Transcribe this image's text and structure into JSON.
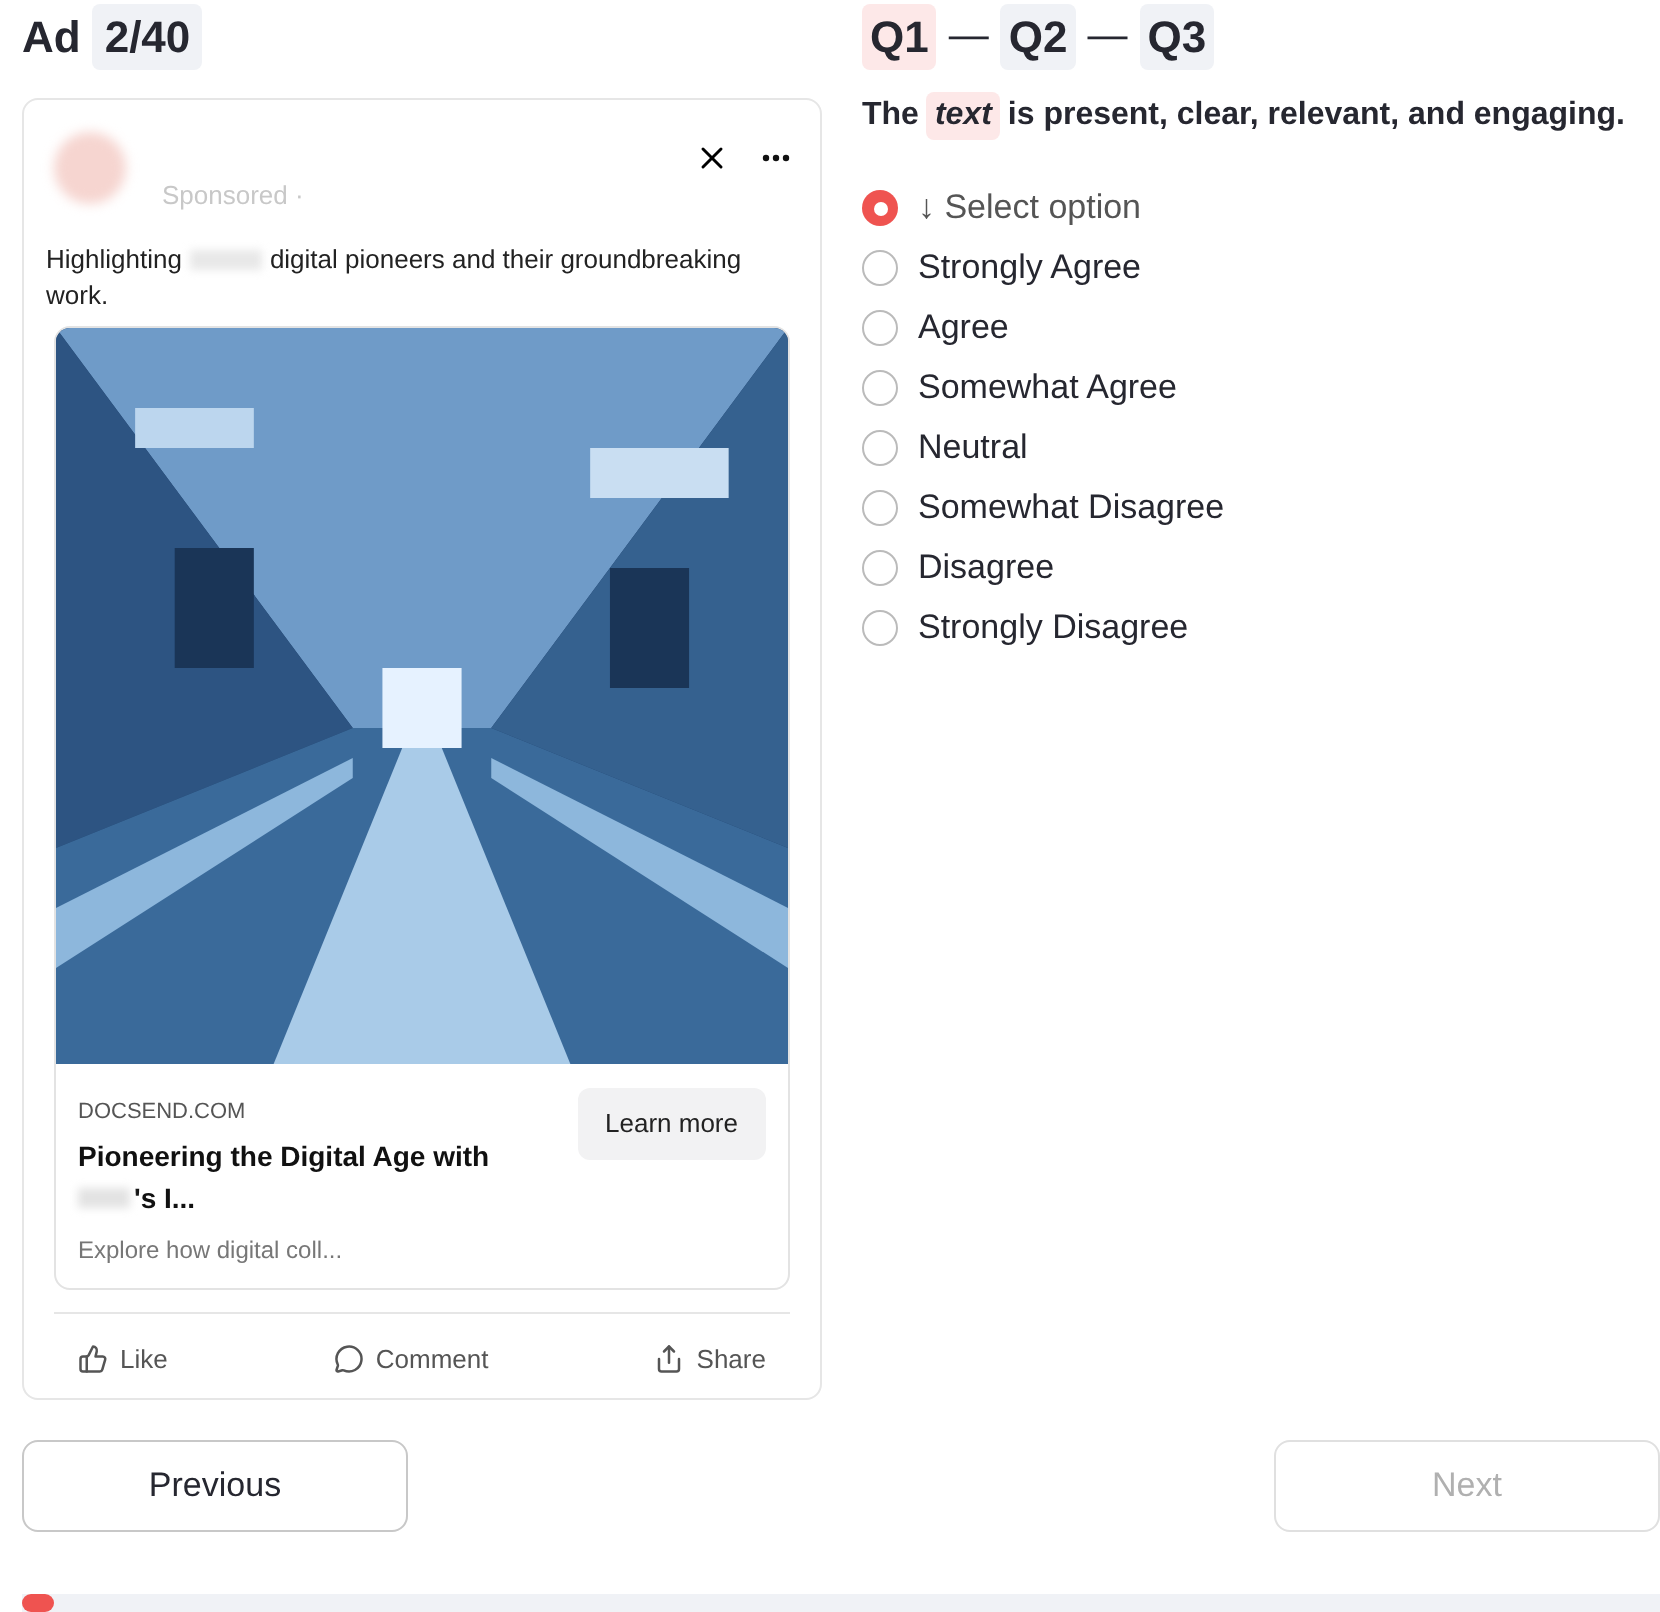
{
  "header": {
    "label": "Ad",
    "counter": "2/40"
  },
  "ad": {
    "sponsored": "Sponsored ·",
    "body_start": "Highlighting",
    "body_end": "digital pioneers and their groundbreaking",
    "body_line2": "work.",
    "domain": "DOCSEND.COM",
    "headline_line1": "Pioneering the Digital Age with",
    "headline_line2": "'s I...",
    "description": "Explore how digital coll...",
    "cta": "Learn more",
    "actions": [
      {
        "kind": "like",
        "label": "Like"
      },
      {
        "kind": "comment",
        "label": "Comment"
      },
      {
        "kind": "share",
        "label": "Share"
      }
    ]
  },
  "step_separator": "—",
  "steps": [
    {
      "label": "Q1",
      "selected": true
    },
    {
      "label": "Q2",
      "selected": false
    },
    {
      "label": "Q3",
      "selected": false
    }
  ],
  "question": {
    "before": "The",
    "highlight": "text",
    "after": "is present, clear, relevant, and engaging."
  },
  "options": [
    {
      "label": "↓ Select option",
      "selected": true
    },
    {
      "label": "Strongly Agree",
      "selected": false
    },
    {
      "label": "Agree",
      "selected": false
    },
    {
      "label": "Somewhat Agree",
      "selected": false
    },
    {
      "label": "Neutral",
      "selected": false
    },
    {
      "label": "Somewhat Disagree",
      "selected": false
    },
    {
      "label": "Disagree",
      "selected": false
    },
    {
      "label": "Strongly Disagree",
      "selected": false
    }
  ],
  "nav": {
    "previous": {
      "label": "Previous",
      "disabled": false
    },
    "next": {
      "label": "Next",
      "disabled": true
    }
  },
  "progress": {
    "level": 0.02
  }
}
